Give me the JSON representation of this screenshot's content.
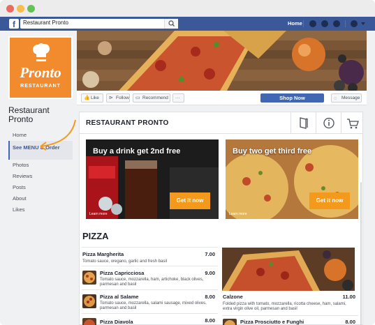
{
  "browser": {
    "dots": [
      "close",
      "minimize",
      "zoom"
    ]
  },
  "fb": {
    "logo": "f",
    "search_value": "Restaurant Pronto",
    "nav_home": "Home",
    "brand_color": "#3b5998"
  },
  "profile": {
    "logo_main": "Pronto",
    "logo_sub": "RESTAURANT"
  },
  "page": {
    "name": "Restaurant Pronto"
  },
  "sidebar": {
    "items": [
      {
        "label": "Home"
      },
      {
        "label": "See MENU & Order"
      },
      {
        "label": "Photos"
      },
      {
        "label": "Reviews"
      },
      {
        "label": "Posts"
      },
      {
        "label": "About"
      },
      {
        "label": "Likes"
      }
    ]
  },
  "actions": {
    "like": "Like",
    "follow": "Follow",
    "recommend": "Recommend",
    "more": "···",
    "shop_now": "Shop Now",
    "message": "Message"
  },
  "tab": {
    "title": "RESTAURANT PRONTO"
  },
  "banners": [
    {
      "title": "Buy a drink get 2nd free",
      "button": "Get it now",
      "learn_more": "Learn more"
    },
    {
      "title": "Buy two get third free",
      "button": "Get it now",
      "learn_more": "Learn more"
    }
  ],
  "menu": {
    "section": "PIZZA",
    "items": [
      {
        "name": "Pizza Margherita",
        "price": "7.00",
        "desc": "Tomato sauce, oregano, garlic and fresh basil"
      },
      {
        "name": "Pizza Capricciosa",
        "price": "9.00",
        "desc": "Tomato sauce, mozzarella, ham, artichoke, black olives, parmesan and basil"
      },
      {
        "name": "Pizza al Salame",
        "price": "8.00",
        "desc": "Tomato sauce, mozzarella, salami sausage, mixed olives, parmesan and basil"
      },
      {
        "name": "Pizza Diavola",
        "price": "8.00",
        "desc": ""
      }
    ],
    "featured": {
      "name": "Calzone",
      "price": "11.00",
      "desc": "Folded pizza with tomato, mozzarella, ricotta cheese, ham, salami, extra virgin olive oil, parmesan and basil"
    },
    "next": {
      "name": "Pizza Prosciutto e Funghi",
      "price": "8.00"
    }
  },
  "colors": {
    "accent_orange": "#f39a1c",
    "shop_blue": "#4267b2"
  }
}
